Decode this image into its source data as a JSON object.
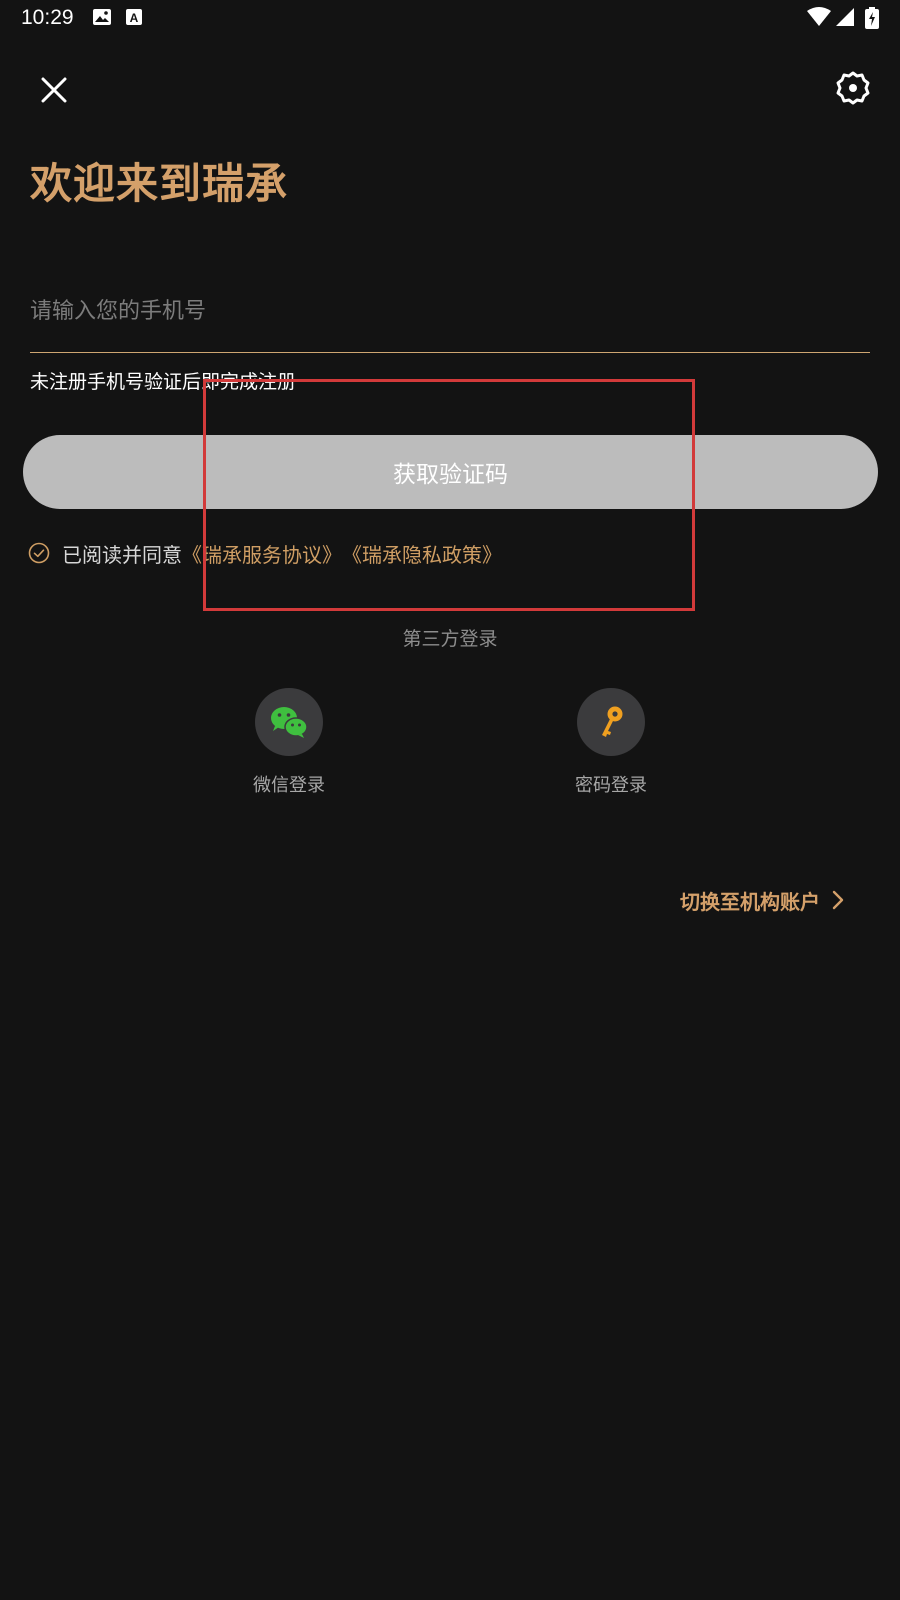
{
  "status_bar": {
    "time": "10:29",
    "icons": [
      "image-icon",
      "a-badge-icon",
      "wifi-icon",
      "signal-icon",
      "battery-charging-icon"
    ]
  },
  "header": {
    "close_icon": "close-icon",
    "settings_icon": "gear-icon"
  },
  "welcome": {
    "title": "欢迎来到瑞承"
  },
  "phone_input": {
    "placeholder": "请输入您的手机号",
    "value": ""
  },
  "hint": "未注册手机号验证后即完成注册",
  "get_code_button": "获取验证码",
  "agreement": {
    "prefix": "已阅读并同意",
    "service_link": "《瑞承服务协议》",
    "privacy_link": "《瑞承隐私政策》"
  },
  "third_party": {
    "label": "第三方登录",
    "options": [
      {
        "label": "微信登录",
        "icon": "wechat-icon"
      },
      {
        "label": "密码登录",
        "icon": "key-icon"
      }
    ]
  },
  "switch_account": {
    "label": "切换至机构账户"
  },
  "colors": {
    "background": "#131313",
    "accent_gold": "#d4a06a",
    "button_disabled": "#bcbcbc",
    "highlight_red": "#d23a3a",
    "wechat_green": "#3fbf3f",
    "key_orange": "#f0a020"
  }
}
